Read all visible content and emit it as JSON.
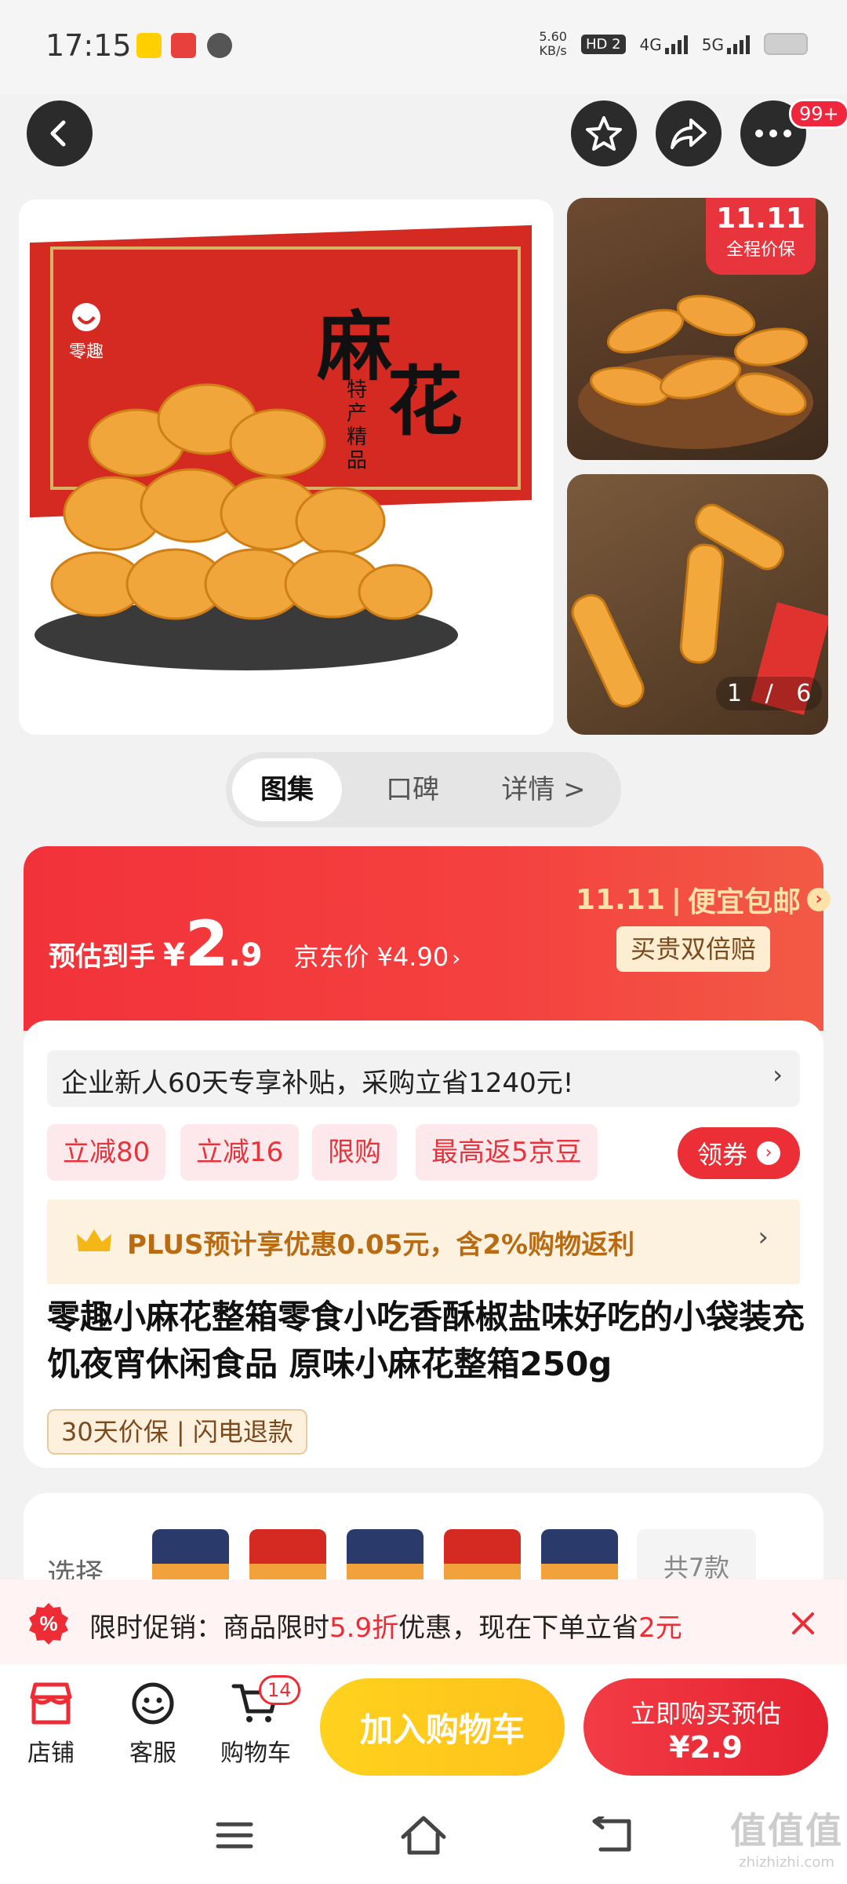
{
  "status": {
    "time": "17:15",
    "net_speed": "5.60\nKB/s",
    "hd": "HD 2",
    "net4g": "4G",
    "net5g": "5G"
  },
  "nav": {
    "more_badge": "99+"
  },
  "gallery": {
    "main_box_text_big1": "麻",
    "main_box_text_big2": "花",
    "main_box_subtitle": "特产精品",
    "main_brand": "零趣",
    "side_badge_top": "11.11",
    "side_badge_bottom": "全程价保",
    "pager": "1 / 6"
  },
  "tabs": [
    "图集",
    "口碑",
    "详情 >"
  ],
  "price": {
    "label": "预估到手",
    "currency": "¥",
    "int": "2",
    "dec": ".9",
    "jd_label": "京东价",
    "jd_price": "¥4.90",
    "event_logo": "11.11",
    "event_text": "便宜包邮",
    "guarantee": "买贵双倍赔"
  },
  "enterprise": {
    "text": "企业新人60天专享补贴，采购立省1240元!"
  },
  "coupons": {
    "tags": [
      "立减80",
      "立减16",
      "限购",
      "最高返5京豆"
    ],
    "claim": "领券"
  },
  "plus": {
    "text_prefix": "PLUS预计享优惠0.05元，含2%购物返利"
  },
  "product": {
    "title": "零趣小麻花整箱零食小吃香酥椒盐味好吃的小袋装充饥夜宵休闲食品 原味小麻花整箱250g",
    "chips": "30天价保 | 闪电退款"
  },
  "select": {
    "label": "选择",
    "count": "共7款"
  },
  "promo": {
    "pre": "限时促销：商品限时",
    "discount": "5.9折",
    "mid": "优惠，现在下单立省",
    "save": "2元"
  },
  "bottom": {
    "shop": "店铺",
    "service": "客服",
    "cart": "购物车",
    "cart_badge": "14",
    "add_cart": "加入购物车",
    "buy_line1": "立即购买预估",
    "buy_line2": "¥2.9"
  },
  "watermark": {
    "text": "值值值",
    "url": "zhizhizhi.com"
  },
  "colors": {
    "accent_red": "#f0263c",
    "cart_yellow": "#ffc91e",
    "plus_gold": "#b86b12"
  }
}
